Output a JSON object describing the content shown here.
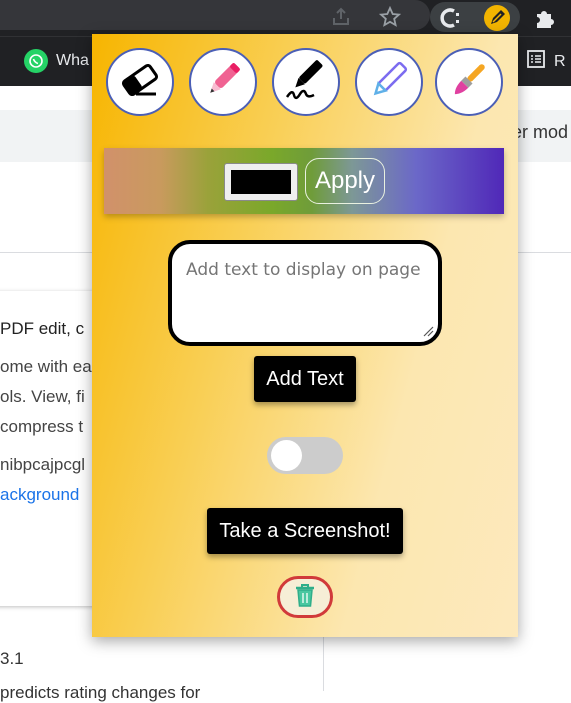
{
  "browser": {
    "bookmark_whatsapp": "Wha",
    "bookmark_reading": "R",
    "icons": [
      "share-icon",
      "star-icon",
      "extension-c-icon",
      "pen-extension-icon",
      "puzzle-icon",
      "whatsapp-icon",
      "reading-list-icon"
    ]
  },
  "page": {
    "right_text": "er mod",
    "card_lines": [
      "PDF edit, c",
      "ome with ea",
      "ols. View, fi",
      "compress t",
      "nibpcajpcgl"
    ],
    "card_link": "ackground",
    "version": "3.1",
    "bottom_text": "predicts rating changes for"
  },
  "popup": {
    "tools": [
      {
        "name": "eraser",
        "icon": "eraser-icon"
      },
      {
        "name": "highlighter",
        "icon": "pink-pen-icon"
      },
      {
        "name": "signature pen",
        "icon": "signature-pen-icon"
      },
      {
        "name": "pencil",
        "icon": "pencil-icon"
      },
      {
        "name": "paint brush",
        "icon": "paint-brush-icon"
      }
    ],
    "color": {
      "value": "#000000",
      "apply_label": "Apply"
    },
    "text_input": {
      "placeholder": "Add text to display on page",
      "value": ""
    },
    "add_text_label": "Add Text",
    "toggle": {
      "on": false
    },
    "screenshot_label": "Take a Screenshot!",
    "delete_icon": "trash-icon"
  },
  "colors": {
    "accent_border": "#4b5fb6",
    "trash_border": "#d13a3a",
    "chrome_bg": "#202124"
  }
}
